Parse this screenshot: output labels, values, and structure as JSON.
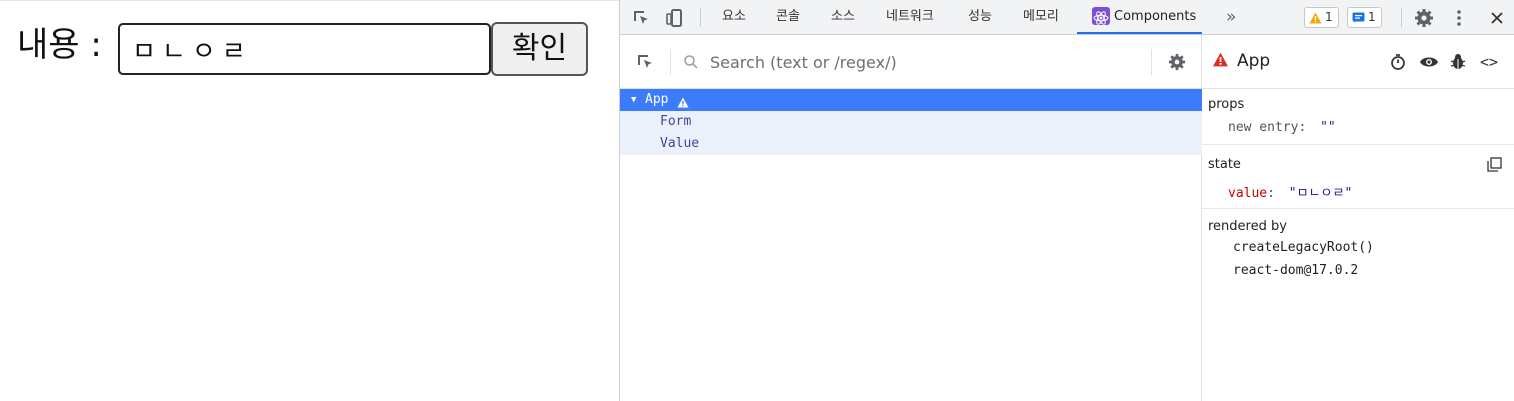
{
  "app": {
    "label": "내용 :",
    "input_value": "ㅁㄴㅇㄹ",
    "button_label": "확인"
  },
  "devtools": {
    "tabs": [
      "요소",
      "콘솔",
      "소스",
      "네트워크",
      "성능",
      "메모리"
    ],
    "active_tab": "Components",
    "more_tabs": "»",
    "warnings_count": "1",
    "messages_count": "1",
    "search_placeholder": "Search (text or /regex/)",
    "tree": {
      "root": "App",
      "children": [
        "Form",
        "Value"
      ]
    },
    "inspector": {
      "component_name": "App",
      "props_title": "props",
      "props_key": "new entry",
      "props_value": "\"\"",
      "state_title": "state",
      "state_key": "value",
      "state_value": "\"ㅁㄴㅇㄹ\"",
      "rendered_by_title": "rendered by",
      "rendered_by": [
        "createLegacyRoot()",
        "react-dom@17.0.2"
      ]
    }
  },
  "colors": {
    "accent": "#1a73e8",
    "selected_row": "#3d7bfd",
    "child_row": "#ebf1fb",
    "state_key": "#c80000",
    "string_value": "#1a1aa6",
    "warning": "#d93025"
  }
}
